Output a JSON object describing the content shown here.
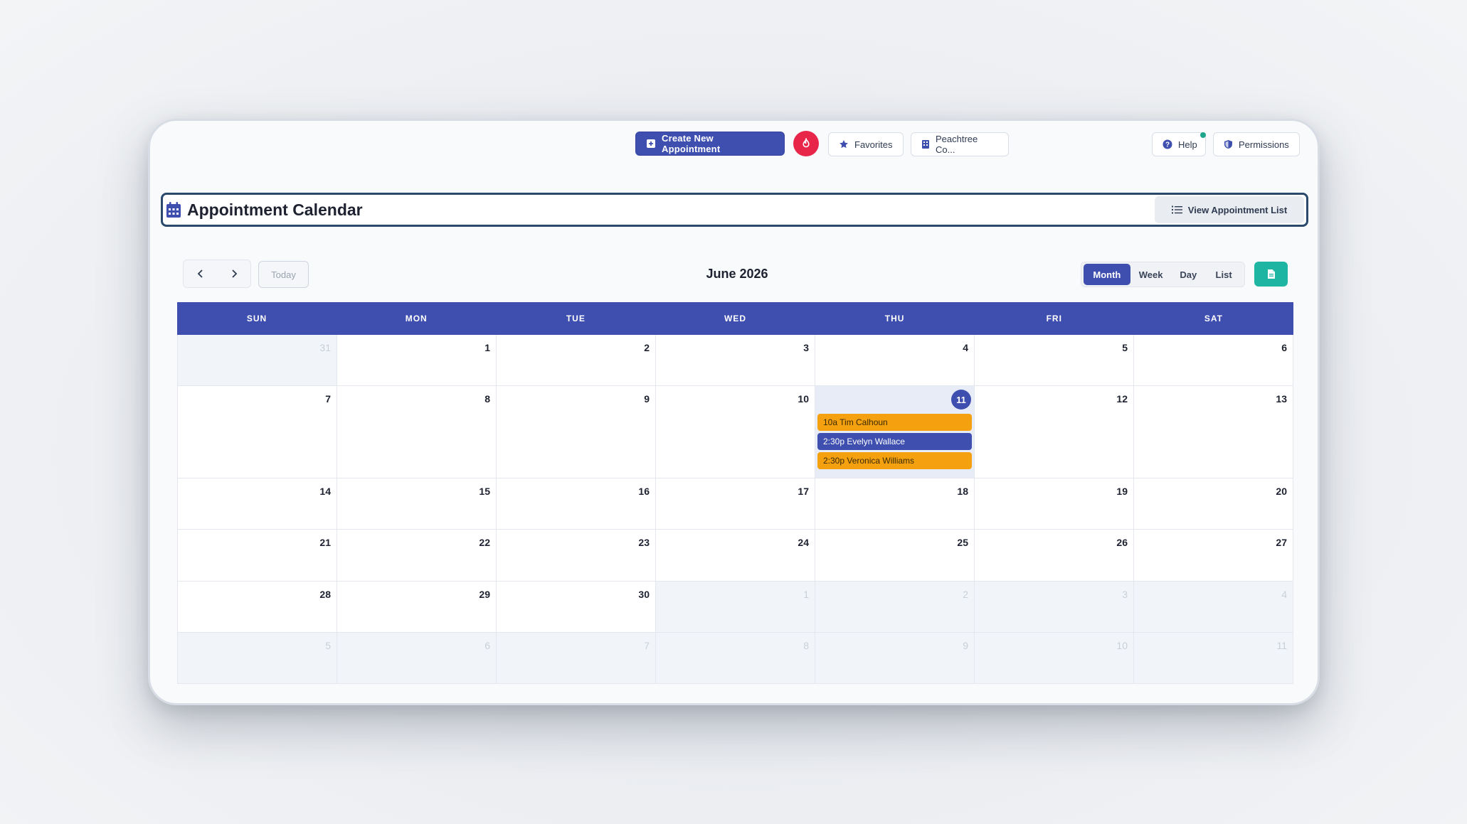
{
  "topbar": {
    "create_label": "Create New Appointment",
    "favorites_label": "Favorites",
    "location_label": "Peachtree Co...",
    "help_label": "Help",
    "permissions_label": "Permissions"
  },
  "header": {
    "title": "Appointment Calendar",
    "view_list_label": "View Appointment List"
  },
  "toolbar": {
    "today_label": "Today",
    "month_title": "June 2026",
    "views": [
      "Month",
      "Week",
      "Day",
      "List"
    ],
    "active_view": "Month"
  },
  "colors": {
    "primary": "#3f4fb0",
    "event_amber": "#f5a10f",
    "export": "#1fb5a3",
    "fire": "#e8264a"
  },
  "calendar": {
    "weekdays": [
      "SUN",
      "MON",
      "TUE",
      "WED",
      "THU",
      "FRI",
      "SAT"
    ],
    "weeks": [
      [
        "31",
        "1",
        "2",
        "3",
        "4",
        "5",
        "6"
      ],
      [
        "7",
        "8",
        "9",
        "10",
        "11",
        "12",
        "13"
      ],
      [
        "14",
        "15",
        "16",
        "17",
        "18",
        "19",
        "20"
      ],
      [
        "21",
        "22",
        "23",
        "24",
        "25",
        "26",
        "27"
      ],
      [
        "28",
        "29",
        "30",
        "1",
        "2",
        "3",
        "4"
      ],
      [
        "5",
        "6",
        "7",
        "8",
        "9",
        "10",
        "11"
      ]
    ],
    "today": "11",
    "events": [
      {
        "label": "10a Tim Calhoun",
        "color": "amber"
      },
      {
        "label": "2:30p Evelyn Wallace",
        "color": "indigo"
      },
      {
        "label": "2:30p Veronica Williams",
        "color": "amber"
      }
    ]
  }
}
